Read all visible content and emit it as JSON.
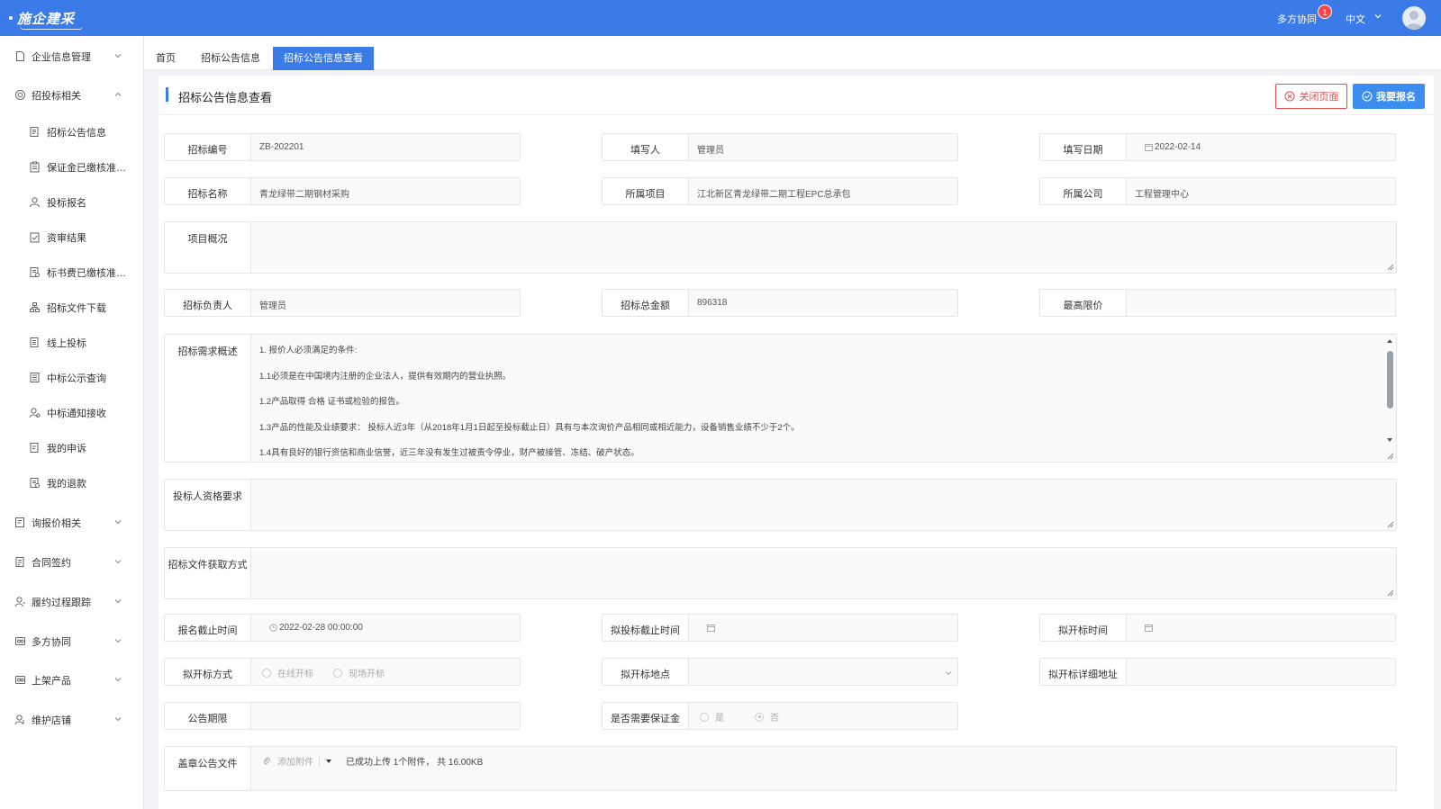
{
  "app": {
    "logo_text": "施企建采",
    "collab_label": "多方协同",
    "notification_count": "1",
    "language": "中文"
  },
  "sidebar": {
    "groups": [
      {
        "label": "企业信息管理",
        "icon": "document-icon"
      },
      {
        "label": "招投标相关",
        "icon": "target-icon",
        "expanded": true
      },
      {
        "label": "询报价相关",
        "icon": "price-list-icon"
      },
      {
        "label": "合同签约",
        "icon": "contract-icon"
      },
      {
        "label": "履约过程跟踪",
        "icon": "user-track-icon"
      },
      {
        "label": "多方协同",
        "icon": "collab-icon"
      },
      {
        "label": "上架产品",
        "icon": "product-icon"
      },
      {
        "label": "维护店铺",
        "icon": "store-user-icon"
      }
    ],
    "sub_items": [
      {
        "label": "招标公告信息",
        "icon": "notice-icon"
      },
      {
        "label": "保证金已缴核准名单",
        "icon": "clipboard-icon"
      },
      {
        "label": "投标报名",
        "icon": "user-icon"
      },
      {
        "label": "资审结果",
        "icon": "check-clipboard-icon"
      },
      {
        "label": "标书费已缴核准名单",
        "icon": "fee-doc-icon"
      },
      {
        "label": "招标文件下载",
        "icon": "org-icon"
      },
      {
        "label": "线上投标",
        "icon": "online-bid-icon"
      },
      {
        "label": "中标公示查询",
        "icon": "list-doc-icon"
      },
      {
        "label": "中标通知接收",
        "icon": "user-bell-icon"
      },
      {
        "label": "我的申诉",
        "icon": "appeal-icon"
      },
      {
        "label": "我的退款",
        "icon": "refund-icon"
      }
    ]
  },
  "tabs": [
    {
      "label": "首页"
    },
    {
      "label": "招标公告信息"
    },
    {
      "label": "招标公告信息查看",
      "active": true
    }
  ],
  "page": {
    "title": "招标公告信息查看",
    "close_button": "关闭页面",
    "signup_button": "我要报名"
  },
  "form": {
    "bid_no": {
      "label": "招标编号",
      "value": "ZB-202201"
    },
    "writer": {
      "label": "填写人",
      "value": "管理员"
    },
    "fill_date": {
      "label": "填写日期",
      "value": "2022-02-14"
    },
    "bid_name": {
      "label": "招标名称",
      "value": "青龙绿带二期钢材采购"
    },
    "project": {
      "label": "所属项目",
      "value": "江北新区青龙绿带二期工程EPC总承包"
    },
    "company": {
      "label": "所属公司",
      "value": "工程管理中心"
    },
    "overview": {
      "label": "项目概况",
      "value": ""
    },
    "leader": {
      "label": "招标负责人",
      "value": "管理员"
    },
    "total_amount": {
      "label": "招标总金额",
      "value": "896318"
    },
    "max_price": {
      "label": "最高限价",
      "value": ""
    },
    "requirements": {
      "label": "招标需求概述",
      "lines": [
        "1. 报价人必须满足的条件:",
        "1.1必须是在中国境内注册的企业法人，提供有效期内的营业执照。",
        "1.2产品取得 合格 证书或检验的报告。",
        "1.3产品的性能及业绩要求： 投标人近3年（从2018年1月1日起至投标截止日）具有与本次询价产品相同或相近能力，设备销售业绩不少于2个。",
        "1.4具有良好的银行资信和商业信誉，近三年没有发生过被责令停业，财产被接管、冻结、破产状态。"
      ]
    },
    "bidder_qual": {
      "label": "投标人资格要求",
      "value": ""
    },
    "doc_method": {
      "label": "招标文件获取方式",
      "value": ""
    },
    "signup_deadline": {
      "label": "报名截止时间",
      "value": "2022-02-28 00:00:00"
    },
    "bid_deadline": {
      "label": "拟投标截止时间",
      "value": ""
    },
    "open_time": {
      "label": "拟开标时间",
      "value": ""
    },
    "open_method": {
      "label": "拟开标方式",
      "options": [
        "在线开标",
        "现场开标"
      ]
    },
    "open_place": {
      "label": "拟开标地点",
      "value": ""
    },
    "open_address": {
      "label": "拟开标详细地址",
      "value": ""
    },
    "notice_period": {
      "label": "公告期限",
      "value": ""
    },
    "need_deposit": {
      "label": "是否需要保证金",
      "options": [
        "是",
        "否"
      ],
      "selected": "否"
    },
    "stamped_file": {
      "label": "盖章公告文件",
      "attach_label": "添加附件",
      "upload_status": "已成功上传 1个附件， 共 16.00KB"
    }
  }
}
